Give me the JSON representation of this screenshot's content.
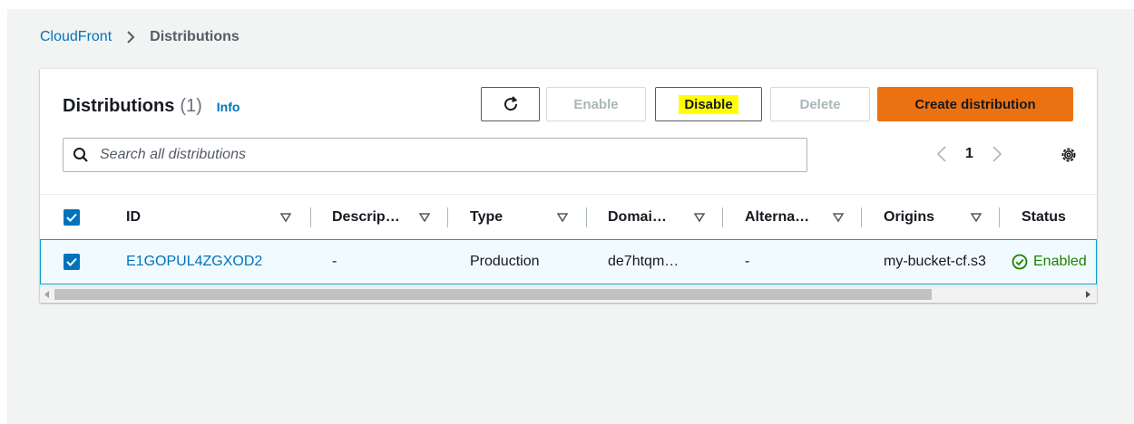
{
  "breadcrumb": {
    "parent": "CloudFront",
    "current": "Distributions"
  },
  "panel": {
    "title": "Distributions",
    "count": "(1)",
    "info": "Info"
  },
  "buttons": {
    "enable": "Enable",
    "disable": "Disable",
    "delete": "Delete",
    "create": "Create distribution"
  },
  "search": {
    "placeholder": "Search all distributions"
  },
  "pagination": {
    "page": "1"
  },
  "table": {
    "columns": [
      "ID",
      "Descrip…",
      "Type",
      "Domai…",
      "Alterna…",
      "Origins",
      "Status"
    ],
    "row": {
      "id": "E1GOPUL4ZGXOD2",
      "description": "-",
      "type": "Production",
      "domain": "de7htqm…",
      "alternate": "-",
      "origins": "my-bucket-cf.s3",
      "status": "Enabled"
    }
  },
  "colors": {
    "link": "#0073bb",
    "primary_button": "#ec7211",
    "success": "#1d8102",
    "highlight": "#ffff00"
  }
}
